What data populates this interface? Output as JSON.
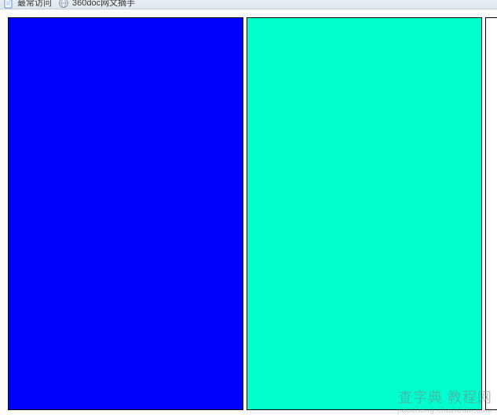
{
  "bookmarks": {
    "items": [
      {
        "label": "最常访问",
        "icon": "page-icon"
      },
      {
        "label": "360doc网文摘手",
        "icon": "globe-icon"
      }
    ]
  },
  "boxes": {
    "colors": [
      "#0000ff",
      "#00ffcc"
    ]
  },
  "watermark": {
    "main": "查字典 教程网",
    "sub": "jiaocheng.chazidian.com"
  }
}
